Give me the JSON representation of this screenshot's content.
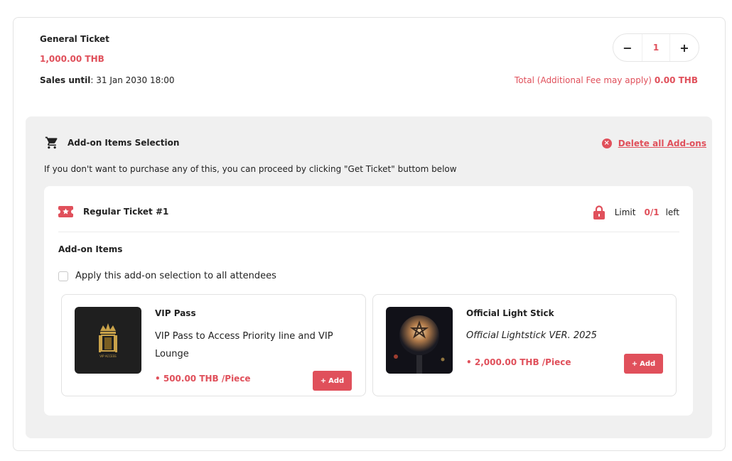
{
  "ticket": {
    "name": "General Ticket",
    "price": "1,000.00 THB",
    "sales_until_label": "Sales until",
    "sales_until_value": ": 31 Jan 2030 18:00",
    "quantity": "1",
    "minus": "−",
    "plus": "+",
    "total_label": "Total (Additional Fee may apply)",
    "total_value": "0.00 THB"
  },
  "addons": {
    "title": "Add-on Items Selection",
    "delete_all": "Delete all Add-ons",
    "hint": "If you don't want to purchase any of this, you can proceed by clicking \"Get Ticket\" buttom below",
    "attendee": {
      "label": "Regular Ticket #1",
      "limit_label": "Limit",
      "limit_value": "0/1",
      "limit_suffix": "left",
      "items_title": "Add-on Items",
      "apply_all": "Apply this add-on selection to all attendees"
    },
    "items": [
      {
        "title": "VIP Pass",
        "description": "VIP Pass to Access Priority line and VIP Lounge",
        "price": "• 500.00 THB /Piece",
        "add_label": "Add",
        "add_icon": "+",
        "thumb_text": "VIP ACCESS"
      },
      {
        "title": "Official Light Stick",
        "description": "Official Lightstick VER. 2025",
        "price": "• 2,000.00 THB /Piece",
        "add_label": "Add",
        "add_icon": "+"
      }
    ]
  },
  "colors": {
    "accent": "#e0505b",
    "panel_bg": "#f0f0f0"
  }
}
